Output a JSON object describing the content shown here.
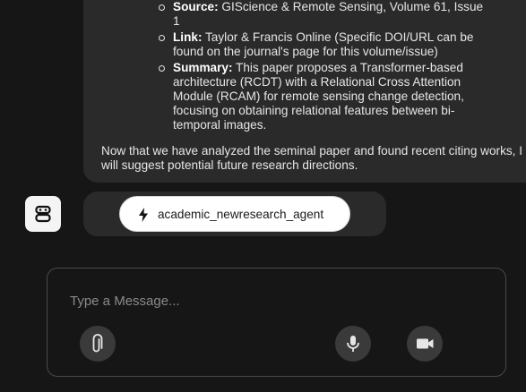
{
  "conversation": {
    "sources": [
      {
        "label": "Source:",
        "text": " GIScience & Remote Sensing, Volume 61, Issue 1"
      },
      {
        "label": "Link:",
        "text": " Taylor & Francis Online (Specific DOI/URL can be found on the journal's page for this volume/issue)"
      },
      {
        "label": "Summary:",
        "text": " This paper proposes a Transformer-based architecture (RCDT) with a Relational Cross Attention Module (RCAM) for remote sensing change detection, focusing on obtaining relational features between bi-temporal images."
      }
    ],
    "closing_text": "Now that we have analyzed the seminal paper and found recent citing works, I will suggest potential future research directions.",
    "tool_call": {
      "icon": "bolt-icon",
      "label": "academic_newresearch_agent"
    },
    "agent_avatar_icon": "robot-icon"
  },
  "composer": {
    "placeholder": "Type a Message...",
    "value": "",
    "attach_icon": "paperclip-icon",
    "mic_icon": "microphone-icon",
    "video_icon": "video-camera-icon"
  },
  "colors": {
    "background": "#161616",
    "bubble": "#2a2a2a",
    "pill": "#ffffff",
    "button": "#3a3a3a",
    "text": "#e6e6e6"
  }
}
